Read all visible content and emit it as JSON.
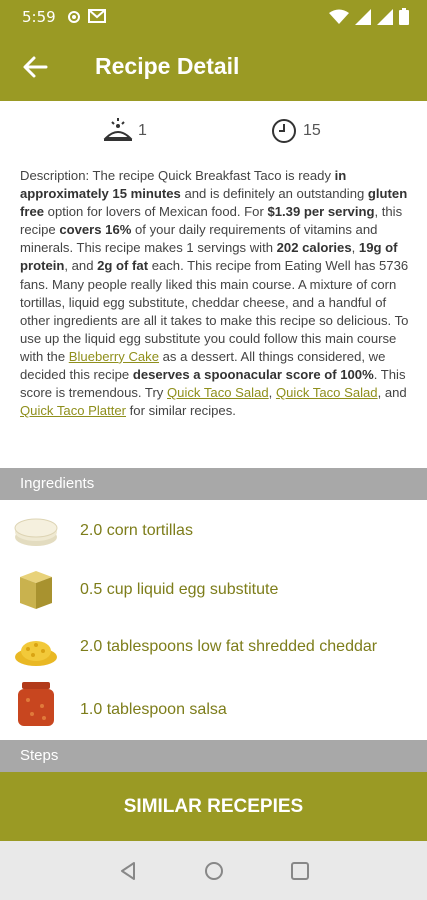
{
  "status_bar": {
    "time": "5:59"
  },
  "app_bar": {
    "title": "Recipe Detail"
  },
  "meta": {
    "servings": "1",
    "minutes": "15"
  },
  "description": {
    "parts": [
      {
        "t": "Description: The recipe Quick Breakfast Taco is ready "
      },
      {
        "b": "in approximately 15 minutes"
      },
      {
        "t": " and is definitely an outstanding "
      },
      {
        "b": "gluten free"
      },
      {
        "t": " option for lovers of Mexican food. For "
      },
      {
        "b": "$1.39 per serving"
      },
      {
        "t": ", this recipe "
      },
      {
        "b": "covers 16%"
      },
      {
        "t": " of your daily requirements of vitamins and minerals. This recipe makes 1 servings with "
      },
      {
        "b": "202 calories"
      },
      {
        "t": ", "
      },
      {
        "b": "19g of protein"
      },
      {
        "t": ", and "
      },
      {
        "b": "2g of fat"
      },
      {
        "t": " each. This recipe from Eating Well has 5736 fans. Many people really liked this main course. A mixture of corn tortillas, liquid egg substitute, cheddar cheese, and a handful of other ingredients are all it takes to make this recipe so delicious. To use up the liquid egg substitute you could follow this main course with the "
      },
      {
        "a": "Blueberry Cake"
      },
      {
        "t": " as a dessert. All things considered, we decided this recipe "
      },
      {
        "b": "deserves a spoonacular score of 100%"
      },
      {
        "t": ". This score is tremendous. Try "
      },
      {
        "a": "Quick Taco Salad"
      },
      {
        "t": ", "
      },
      {
        "a": "Quick Taco Salad"
      },
      {
        "t": ", and "
      },
      {
        "a": "Quick Taco Platter"
      },
      {
        "t": " for similar recipes."
      }
    ]
  },
  "sections": {
    "ingredients": "Ingredients",
    "steps": "Steps"
  },
  "ingredients": [
    {
      "label": "2.0  corn tortillas",
      "icon": "tortilla-icon"
    },
    {
      "label": "0.5 cup liquid egg substitute",
      "icon": "egg-carton-icon"
    },
    {
      "label": "2.0 tablespoons low fat shredded cheddar",
      "icon": "cheese-icon"
    },
    {
      "label": "1.0 tablespoon salsa",
      "icon": "salsa-jar-icon"
    }
  ],
  "similar_button": {
    "label": "SIMILAR RECEPIES"
  },
  "colors": {
    "primary": "#9a9a24",
    "accent_text": "#7d7d1a",
    "section_gray": "#a8a8a8"
  }
}
